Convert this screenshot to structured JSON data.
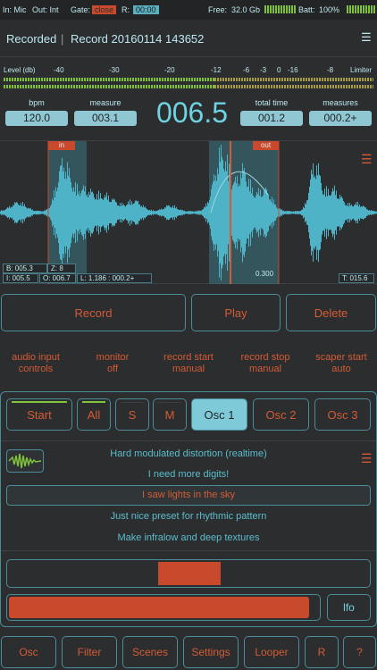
{
  "status": {
    "input": "In: Mic",
    "output": "Out: Int",
    "gate_label": "Gate:",
    "gate_value": "close",
    "r_label": "R:",
    "r_value": "00:00",
    "free_label": "Free:",
    "free_value": "32.0 Gb",
    "batt_label": "Batt:",
    "batt_value": "100%"
  },
  "header": {
    "status_text": "Recorded",
    "record_name": "Record 20160114 143652"
  },
  "level_scale": {
    "label": "Level (db)",
    "ticks": [
      "-40",
      "-30",
      "-20",
      "-12",
      "-6",
      "-3",
      "0",
      "-16",
      "-8"
    ],
    "limiter_label": "Limiter"
  },
  "metrics": {
    "bpm_label": "bpm",
    "bpm_value": "120.0",
    "measure_label": "measure",
    "measure_value": "003.1",
    "big_value": "006.5",
    "total_time_label": "total time",
    "total_time_value": "001.2",
    "measures_label": "measures",
    "measures_value": "000.2+"
  },
  "waveform": {
    "in_label": "in",
    "out_label": "out",
    "cursor_value": "0.300",
    "readout_b": "B: 005.3",
    "readout_z": "Z: 8",
    "readout_i": "I: 005.5",
    "readout_o": "O: 006.7",
    "readout_l": "L: 1.186 : 000.2+",
    "readout_t": "T: 015.6"
  },
  "transport": {
    "record": "Record",
    "play": "Play",
    "delete": "Delete"
  },
  "options": [
    {
      "line1": "audio input",
      "line2": "controls"
    },
    {
      "line1": "monitor",
      "line2": "off"
    },
    {
      "line1": "record start",
      "line2": "manual"
    },
    {
      "line1": "record stop",
      "line2": "manual"
    },
    {
      "line1": "scaper start",
      "line2": "auto"
    }
  ],
  "tabs": {
    "start": "Start",
    "all": "All",
    "s": "S",
    "m": "M",
    "osc1": "Osc 1",
    "osc2": "Osc 2",
    "osc3": "Osc 3"
  },
  "presets": [
    "Hard modulated distortion (realtime)",
    "I need more digits!",
    "I saw lights in the sky",
    "Just nice preset for rhythmic pattern",
    "Make infralow and deep textures"
  ],
  "sliders": {
    "lfo_label": "lfo",
    "position_fraction": 0.5,
    "level_fraction": 0.97
  },
  "bottom_nav": {
    "osc": "Osc",
    "filter": "Filter",
    "scenes": "Scenes",
    "settings": "Settings",
    "looper": "Looper",
    "r": "R",
    "help": "?"
  },
  "colors": {
    "accent_orange": "#d55b34",
    "accent_cyan": "#6fd3e2",
    "meter_green": "#7fbf3a",
    "background": "#2b2d2f"
  }
}
